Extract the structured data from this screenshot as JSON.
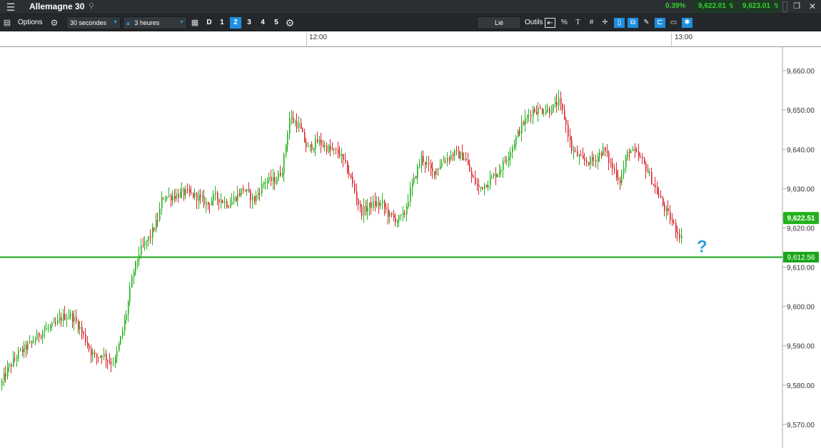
{
  "title_bar": {
    "instrument": "Allemagne 30",
    "change_pct": "0.39%",
    "sell_price": "9,622.01",
    "buy_price": "9,623.01"
  },
  "toolbar": {
    "options_label": "Options",
    "interval_value": "30 secondes",
    "range_value": "3 heures",
    "period_d": "D",
    "panes": [
      "1",
      "2",
      "3",
      "4",
      "5"
    ],
    "active_pane": "2",
    "linked_label": "Lié",
    "tools_label": "Outils",
    "percent_label": "%"
  },
  "icons": {
    "menu": "hamburger-menu-icon",
    "search": "search-icon",
    "settings": "gear-icon",
    "calendar": "calendar-icon",
    "lock": "lock-icon",
    "restore": "restore-window-icon",
    "close": "close-icon"
  },
  "colors": {
    "up": "#22b21c",
    "down": "#d9262c",
    "accent": "#1e8fe0",
    "level_line": "#1aa61a",
    "question": "#2f9fd8"
  },
  "chart_data": {
    "type": "candlestick",
    "x_ticks": [
      "12:00",
      "13:00"
    ],
    "y_ticks": [
      "9,570.00",
      "9,580.00",
      "9,590.00",
      "9,600.00",
      "9,610.00",
      "9,620.00",
      "9,630.00",
      "9,640.00",
      "9,650.00",
      "9,660.00"
    ],
    "ylim": [
      9564,
      9666
    ],
    "grid": false,
    "current_price": 9622.51,
    "current_price_label": "9,622.51",
    "level": 9612.56,
    "level_label": "9,612.56",
    "question_mark": "?",
    "path": [
      [
        0,
        9580
      ],
      [
        10,
        9584
      ],
      [
        25,
        9588
      ],
      [
        45,
        9591
      ],
      [
        60,
        9594
      ],
      [
        75,
        9595
      ],
      [
        85,
        9597
      ],
      [
        95,
        9598
      ],
      [
        102,
        9597
      ],
      [
        110,
        9595
      ],
      [
        118,
        9592
      ],
      [
        125,
        9589
      ],
      [
        133,
        9587
      ],
      [
        143,
        9588
      ],
      [
        152,
        9586
      ],
      [
        160,
        9586
      ],
      [
        170,
        9593
      ],
      [
        178,
        9600
      ],
      [
        185,
        9608
      ],
      [
        195,
        9614
      ],
      [
        210,
        9618
      ],
      [
        220,
        9622
      ],
      [
        227,
        9628
      ],
      [
        240,
        9628
      ],
      [
        258,
        9629
      ],
      [
        275,
        9628
      ],
      [
        290,
        9626
      ],
      [
        300,
        9628
      ],
      [
        320,
        9626
      ],
      [
        340,
        9630
      ],
      [
        355,
        9627
      ],
      [
        370,
        9632
      ],
      [
        385,
        9632
      ],
      [
        395,
        9635
      ],
      [
        405,
        9648
      ],
      [
        418,
        9646
      ],
      [
        430,
        9640
      ],
      [
        445,
        9642
      ],
      [
        460,
        9640
      ],
      [
        475,
        9639
      ],
      [
        490,
        9633
      ],
      [
        505,
        9624
      ],
      [
        520,
        9626
      ],
      [
        535,
        9626
      ],
      [
        545,
        9623
      ],
      [
        555,
        9622
      ],
      [
        565,
        9623
      ],
      [
        575,
        9630
      ],
      [
        590,
        9638
      ],
      [
        605,
        9634
      ],
      [
        620,
        9637
      ],
      [
        635,
        9639
      ],
      [
        650,
        9638
      ],
      [
        660,
        9633
      ],
      [
        670,
        9630
      ],
      [
        685,
        9632
      ],
      [
        700,
        9635
      ],
      [
        715,
        9640
      ],
      [
        730,
        9646
      ],
      [
        745,
        9650
      ],
      [
        760,
        9650
      ],
      [
        770,
        9650
      ],
      [
        782,
        9652
      ],
      [
        790,
        9648
      ],
      [
        800,
        9640
      ],
      [
        815,
        9637
      ],
      [
        830,
        9637
      ],
      [
        845,
        9640
      ],
      [
        855,
        9636
      ],
      [
        868,
        9632
      ],
      [
        880,
        9640
      ],
      [
        895,
        9638
      ],
      [
        905,
        9635
      ],
      [
        920,
        9629
      ],
      [
        930,
        9625
      ],
      [
        945,
        9620
      ],
      [
        955,
        9617
      ]
    ]
  }
}
